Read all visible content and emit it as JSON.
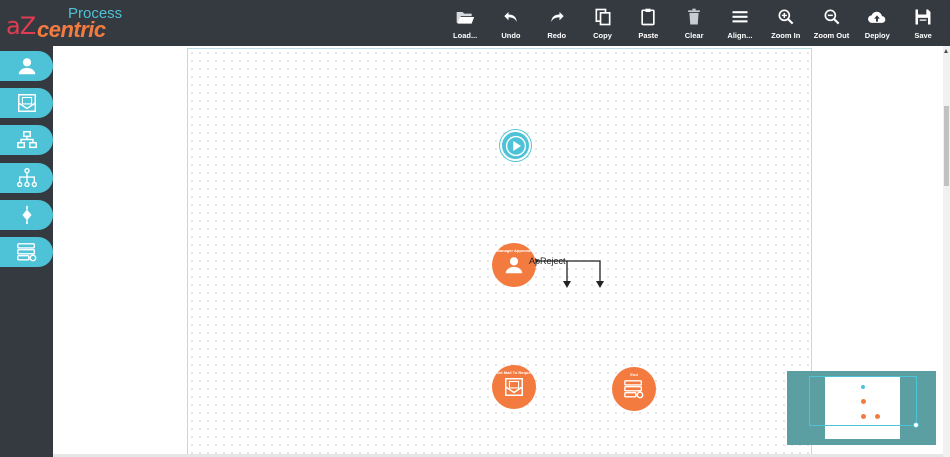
{
  "app": {
    "logo_az": "aZ",
    "logo_process": "Process",
    "logo_centric": "centric"
  },
  "toolbar": [
    {
      "icon": "folder-open-icon",
      "label": "Load..."
    },
    {
      "icon": "undo-icon",
      "label": "Undo"
    },
    {
      "icon": "redo-icon",
      "label": "Redo"
    },
    {
      "icon": "copy-icon",
      "label": "Copy"
    },
    {
      "icon": "paste-icon",
      "label": "Paste"
    },
    {
      "icon": "trash-icon",
      "label": "Clear"
    },
    {
      "icon": "align-icon",
      "label": "Align..."
    },
    {
      "icon": "zoom-in-icon",
      "label": "Zoom In"
    },
    {
      "icon": "zoom-out-icon",
      "label": "Zoom Out"
    },
    {
      "icon": "cloud-upload-icon",
      "label": "Deploy"
    },
    {
      "icon": "floppy-disk-icon",
      "label": "Save"
    }
  ],
  "sidebar": [
    {
      "icon": "user-task-icon"
    },
    {
      "icon": "email-task-icon"
    },
    {
      "icon": "sub-process-icon"
    },
    {
      "icon": "hierarchy-icon"
    },
    {
      "icon": "gateway-icon"
    },
    {
      "icon": "database-settings-icon"
    }
  ],
  "canvas": {
    "nodes": {
      "start": {
        "icon": "play-icon"
      },
      "task": {
        "title": "Manager Approval",
        "icon": "user-icon"
      },
      "mail": {
        "title": "Email Mail To Requester",
        "icon": "envelope-icon"
      },
      "end": {
        "title": "End",
        "icon": "database-settings-icon"
      }
    },
    "connector_label": "ApReject"
  },
  "colors": {
    "topbar": "#343a40",
    "accent": "#4ec2d6",
    "node": "#f47b3f",
    "minimap": "#5c9fa2",
    "logo_red": "#e23b52"
  }
}
